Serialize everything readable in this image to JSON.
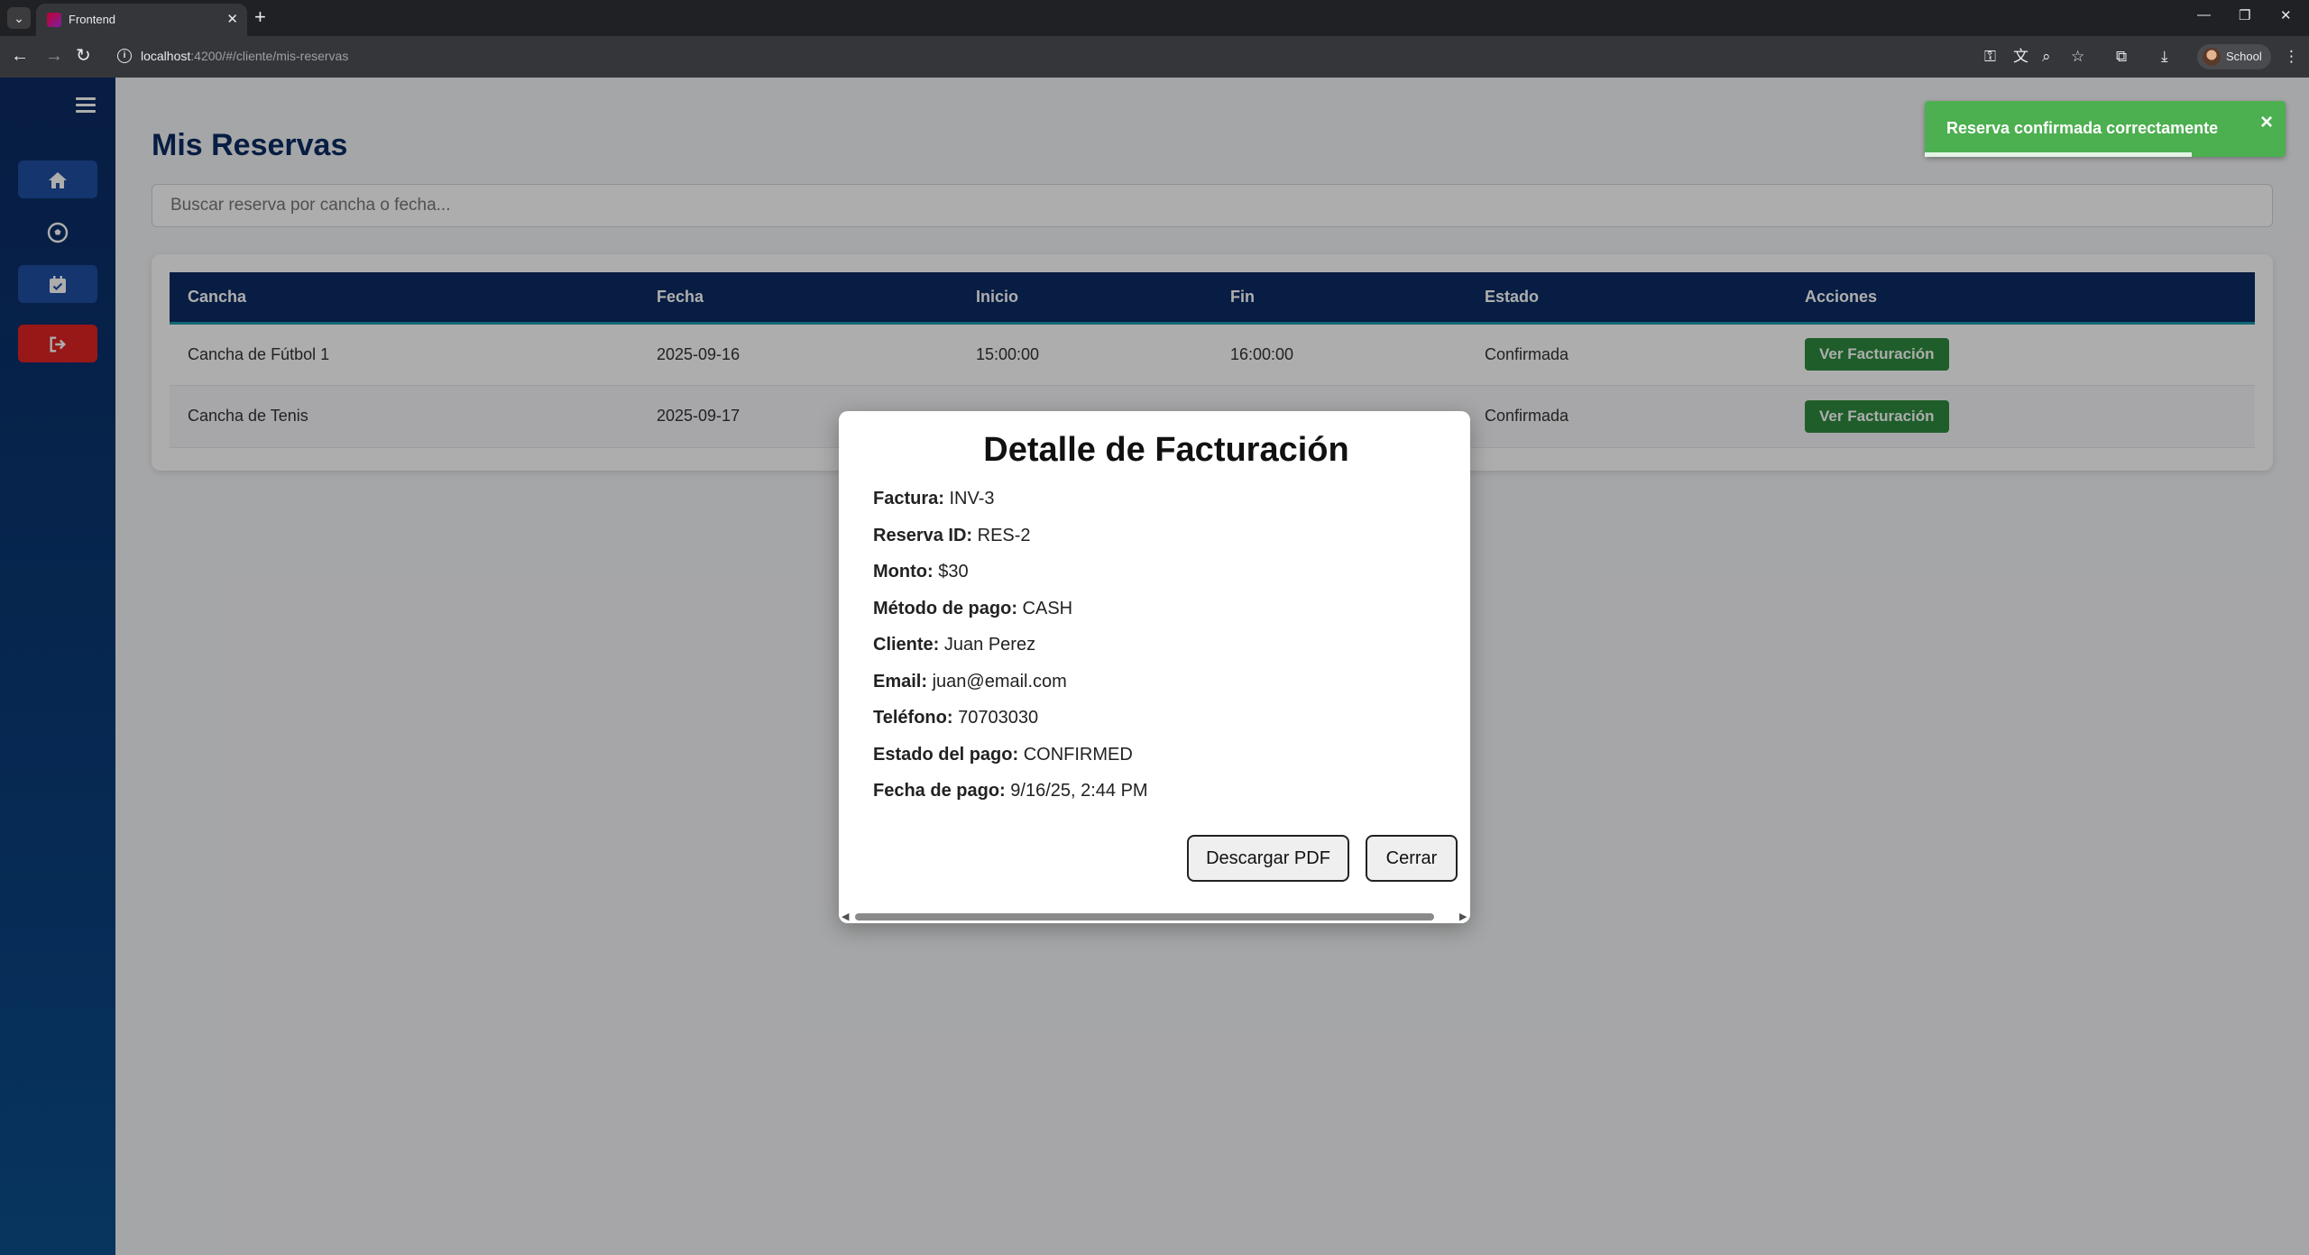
{
  "browser": {
    "tab_title": "Frontend",
    "url_host": "localhost",
    "url_rest": ":4200/#/cliente/mis-reservas",
    "profile_name": "School"
  },
  "sidebar": {
    "items": [
      {
        "icon": "home-icon"
      },
      {
        "icon": "soccer-ball-icon"
      },
      {
        "icon": "calendar-check-icon"
      },
      {
        "icon": "logout-icon"
      }
    ]
  },
  "page": {
    "title": "Mis Reservas",
    "search_placeholder": "Buscar reserva por cancha o fecha..."
  },
  "table": {
    "headers": [
      "Cancha",
      "Fecha",
      "Inicio",
      "Fin",
      "Estado",
      "Acciones"
    ],
    "rows": [
      {
        "cancha": "Cancha de Fútbol 1",
        "fecha": "2025-09-16",
        "inicio": "15:00:00",
        "fin": "16:00:00",
        "estado": "Confirmada",
        "accion": "Ver Facturación"
      },
      {
        "cancha": "Cancha de Tenis",
        "fecha": "2025-09-17",
        "inicio": "",
        "fin": "",
        "estado": "Confirmada",
        "accion": "Ver Facturación"
      }
    ]
  },
  "toast": {
    "message": "Reserva confirmada correctamente",
    "close": "×",
    "progress": 0.74,
    "color": "#4caf50"
  },
  "modal": {
    "title": "Detalle de Facturación",
    "fields": [
      {
        "label": "Factura:",
        "value": "INV-3"
      },
      {
        "label": "Reserva ID:",
        "value": "RES-2"
      },
      {
        "label": "Monto:",
        "value": "$30"
      },
      {
        "label": "Método de pago:",
        "value": "CASH"
      },
      {
        "label": "Cliente:",
        "value": "Juan Perez"
      },
      {
        "label": "Email:",
        "value": "juan@email.com"
      },
      {
        "label": "Teléfono:",
        "value": "70703030"
      },
      {
        "label": "Estado del pago:",
        "value": "CONFIRMED"
      },
      {
        "label": "Fecha de pago:",
        "value": "9/16/25, 2:44 PM"
      }
    ],
    "download_label": "Descargar PDF",
    "close_label": "Cerrar"
  },
  "colors": {
    "brand": "#0b2b63",
    "action": "#2e8b3e",
    "logout": "#e02424"
  }
}
